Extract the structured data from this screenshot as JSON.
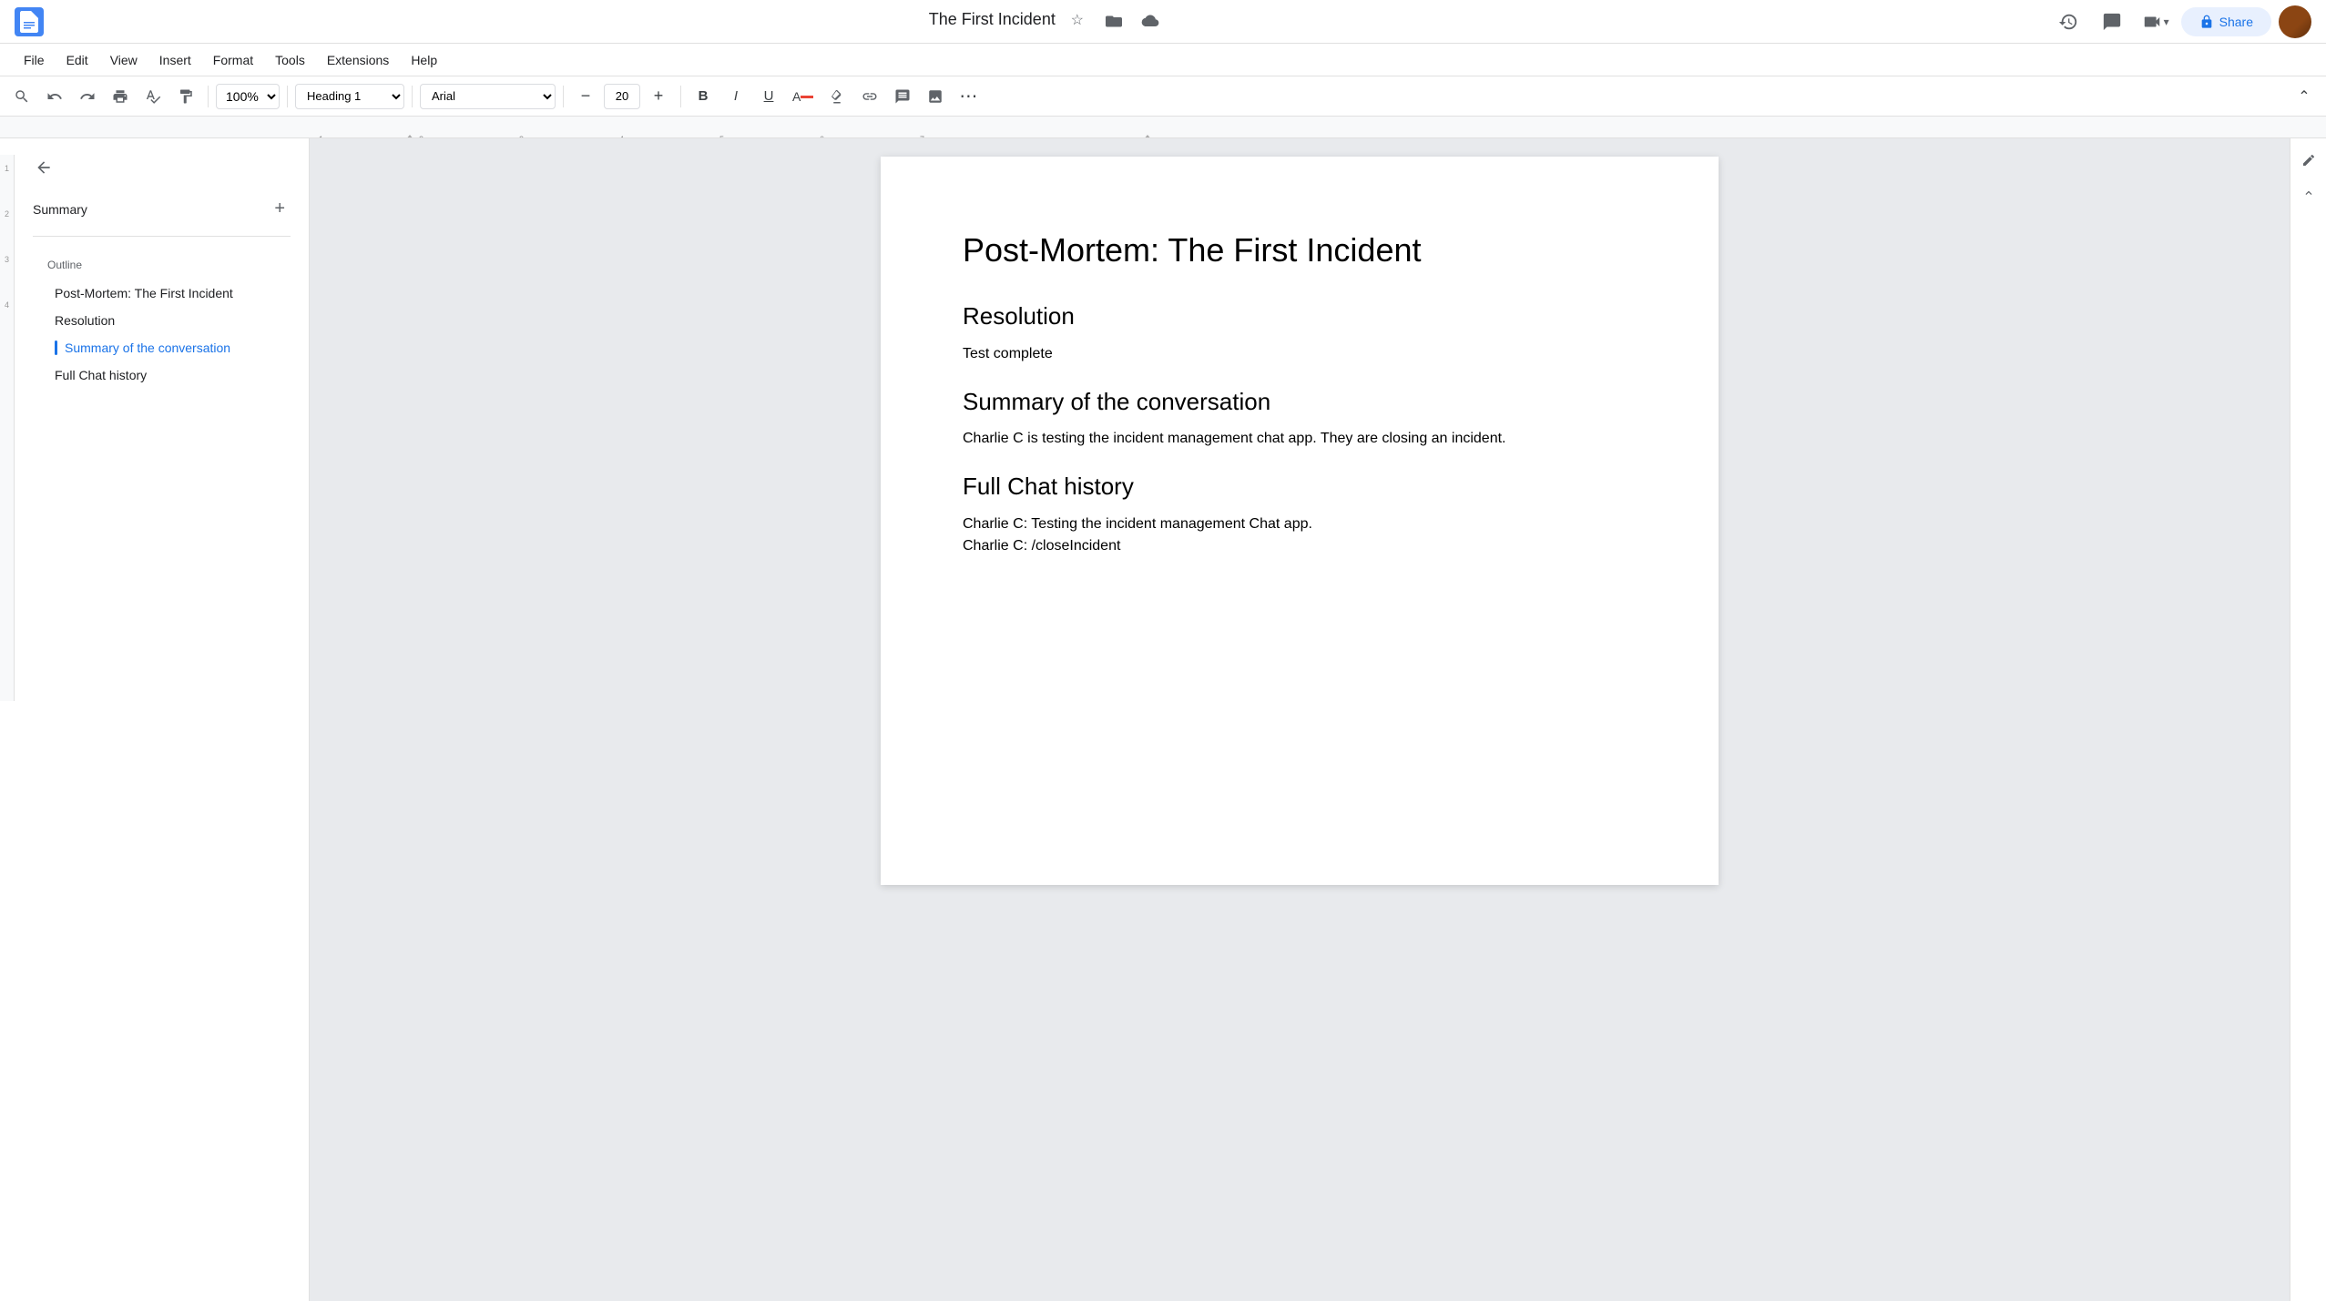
{
  "titlebar": {
    "doc_icon_color": "#4285f4",
    "doc_title": "The First Incident",
    "star_icon": "☆",
    "folder_icon": "📁",
    "cloud_icon": "☁",
    "history_icon": "⟳",
    "comment_icon": "💬",
    "video_icon": "📹",
    "share_btn_label": "Share",
    "share_icon": "🔒",
    "edit_icon": "✏",
    "chevron_icon": "⌄"
  },
  "menubar": {
    "items": [
      {
        "id": "file",
        "label": "File"
      },
      {
        "id": "edit",
        "label": "Edit"
      },
      {
        "id": "view",
        "label": "View"
      },
      {
        "id": "insert",
        "label": "Insert"
      },
      {
        "id": "format",
        "label": "Format"
      },
      {
        "id": "tools",
        "label": "Tools"
      },
      {
        "id": "extensions",
        "label": "Extensions"
      },
      {
        "id": "help",
        "label": "Help"
      }
    ]
  },
  "toolbar": {
    "search_icon": "🔍",
    "undo_icon": "↩",
    "redo_icon": "↪",
    "print_icon": "🖨",
    "spell_icon": "✓",
    "paint_icon": "🖊",
    "zoom_value": "100%",
    "style_value": "Heading 1",
    "font_value": "Arial",
    "font_size_value": "20",
    "decrease_font_icon": "−",
    "increase_font_icon": "+",
    "bold_label": "B",
    "italic_label": "I",
    "underline_label": "U",
    "text_color_icon": "A",
    "highlight_icon": "✏",
    "link_icon": "🔗",
    "comment_icon": "💬",
    "image_icon": "🖼",
    "more_icon": "⋯",
    "collapse_icon": "⌃"
  },
  "sidebar": {
    "back_icon": "←",
    "summary_label": "Summary",
    "add_icon": "+",
    "outline_label": "Outline",
    "outline_items": [
      {
        "id": "title",
        "label": "Post-Mortem: The First Incident",
        "active": false
      },
      {
        "id": "resolution",
        "label": "Resolution",
        "active": false
      },
      {
        "id": "summary",
        "label": "Summary of the conversation",
        "active": true
      },
      {
        "id": "fullchat",
        "label": "Full Chat history",
        "active": false
      }
    ]
  },
  "document": {
    "title": "Post-Mortem: The First Incident",
    "sections": [
      {
        "id": "resolution",
        "heading": "Resolution",
        "body": "Test complete"
      },
      {
        "id": "summary",
        "heading": "Summary of the conversation",
        "body": "Charlie C is testing the incident management chat app. They are closing an incident."
      },
      {
        "id": "fullchat",
        "heading": "Full Chat history",
        "body_lines": [
          "Charlie C: Testing the incident management Chat app.",
          "Charlie C: /closeIncident"
        ]
      }
    ]
  }
}
